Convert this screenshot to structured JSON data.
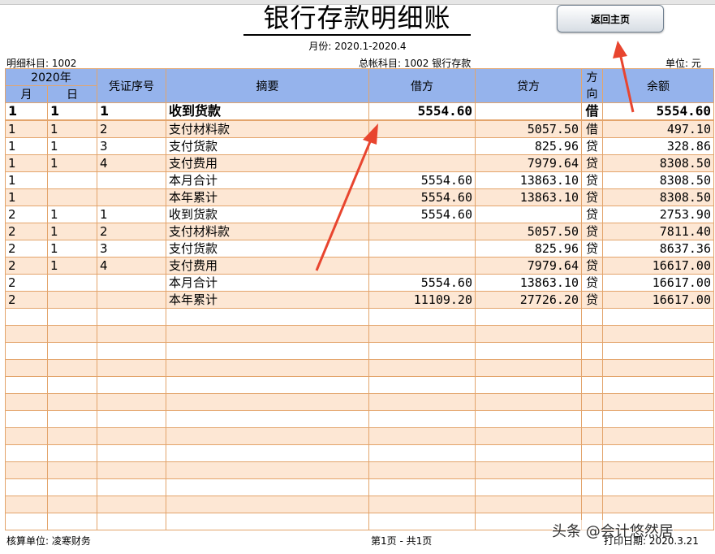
{
  "title": "银行存款明细账",
  "period": "月份: 2020.1-2020.4",
  "return_button": "返回主页",
  "info": {
    "detail_account": "明细科目: 1002",
    "general_account": "总帐科目: 1002   银行存款",
    "unit": "单位: 元"
  },
  "headers": {
    "year": "2020年",
    "month": "月",
    "day": "日",
    "voucher": "凭证序号",
    "summary": "摘要",
    "debit": "借方",
    "credit": "贷方",
    "direction": "方\n向",
    "balance": "余额"
  },
  "rows": [
    {
      "m": "1",
      "d": "1",
      "v": "1",
      "s": "收到货款",
      "dr": "5554.60",
      "cr": "",
      "dir": "借",
      "bal": "5554.60"
    },
    {
      "m": "1",
      "d": "1",
      "v": "2",
      "s": "支付材料款",
      "dr": "",
      "cr": "5057.50",
      "dir": "借",
      "bal": "497.10"
    },
    {
      "m": "1",
      "d": "1",
      "v": "3",
      "s": "支付货款",
      "dr": "",
      "cr": "825.96",
      "dir": "贷",
      "bal": "328.86"
    },
    {
      "m": "1",
      "d": "1",
      "v": "4",
      "s": "支付费用",
      "dr": "",
      "cr": "7979.64",
      "dir": "贷",
      "bal": "8308.50"
    },
    {
      "m": "1",
      "d": "",
      "v": "",
      "s": "本月合计",
      "dr": "5554.60",
      "cr": "13863.10",
      "dir": "贷",
      "bal": "8308.50"
    },
    {
      "m": "1",
      "d": "",
      "v": "",
      "s": "本年累计",
      "dr": "5554.60",
      "cr": "13863.10",
      "dir": "贷",
      "bal": "8308.50"
    },
    {
      "m": "2",
      "d": "1",
      "v": "1",
      "s": "收到货款",
      "dr": "5554.60",
      "cr": "",
      "dir": "贷",
      "bal": "2753.90"
    },
    {
      "m": "2",
      "d": "1",
      "v": "2",
      "s": "支付材料款",
      "dr": "",
      "cr": "5057.50",
      "dir": "贷",
      "bal": "7811.40"
    },
    {
      "m": "2",
      "d": "1",
      "v": "3",
      "s": "支付货款",
      "dr": "",
      "cr": "825.96",
      "dir": "贷",
      "bal": "8637.36"
    },
    {
      "m": "2",
      "d": "1",
      "v": "4",
      "s": "支付费用",
      "dr": "",
      "cr": "7979.64",
      "dir": "贷",
      "bal": "16617.00"
    },
    {
      "m": "2",
      "d": "",
      "v": "",
      "s": "本月合计",
      "dr": "5554.60",
      "cr": "13863.10",
      "dir": "贷",
      "bal": "16617.00"
    },
    {
      "m": "2",
      "d": "",
      "v": "",
      "s": "本年累计",
      "dr": "11109.20",
      "cr": "27726.20",
      "dir": "贷",
      "bal": "16617.00"
    }
  ],
  "footer": {
    "company": "核算单位: 凌寒财务",
    "page": "第1页 - 共1页",
    "watermark": "头条 @会计悠然居",
    "print_date": "打印日期: 2020.3.21"
  },
  "colors": {
    "header_bg": "#95b3ec",
    "row_bg": "#fde7d4",
    "border": "#e3a46b",
    "arrow": "#e8452f"
  }
}
